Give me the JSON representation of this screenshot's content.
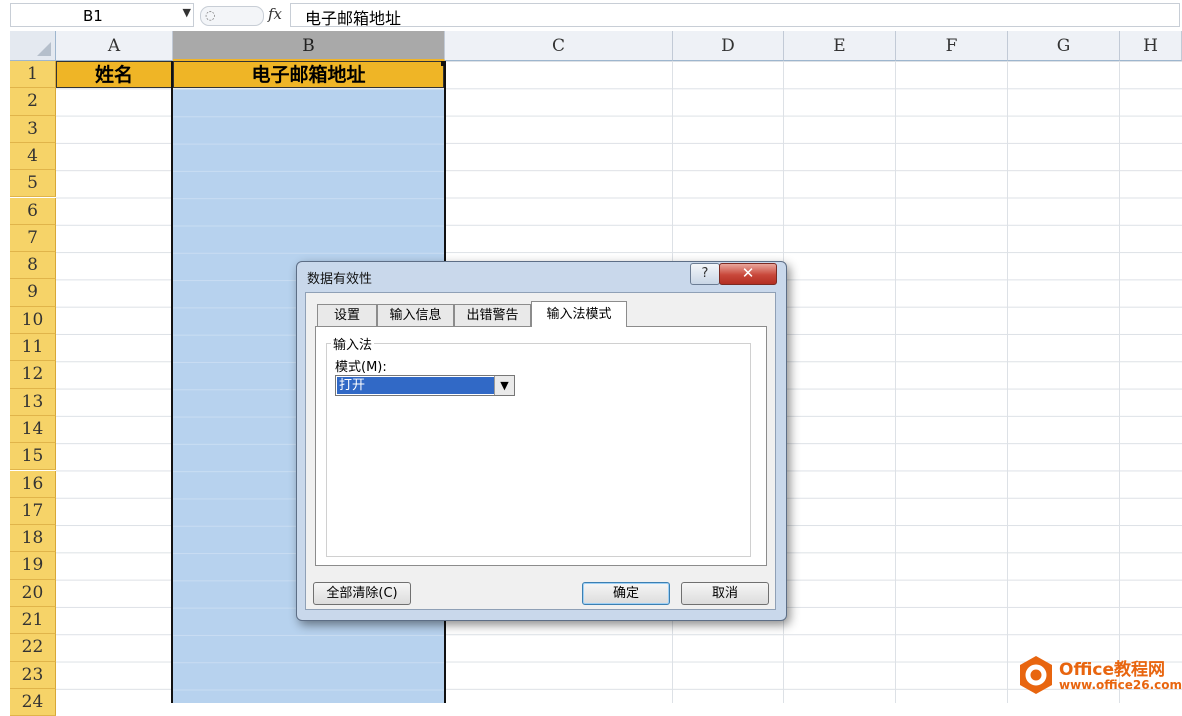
{
  "formula_bar": {
    "name_box": "B1",
    "fx": "fx",
    "formula": "电子邮箱地址"
  },
  "sheet": {
    "columns": [
      "A",
      "B",
      "C",
      "D",
      "E",
      "F",
      "G",
      "H"
    ],
    "selected_column": "B",
    "rows": [
      "1",
      "2",
      "3",
      "4",
      "5",
      "6",
      "7",
      "8",
      "9",
      "10",
      "11",
      "12",
      "13",
      "14",
      "15",
      "16",
      "17",
      "18",
      "19",
      "20",
      "21",
      "22",
      "23",
      "24"
    ],
    "cells": {
      "A1": "姓名",
      "B1": "电子邮箱地址"
    },
    "colors": {
      "header_fill": "#efb526",
      "selection": "#b7d2ee",
      "row_header": "#f6d368"
    }
  },
  "dialog": {
    "title": "数据有效性",
    "help": "?",
    "close": "✕",
    "tabs": [
      "设置",
      "输入信息",
      "出错警告",
      "输入法模式"
    ],
    "active_tab": "输入法模式",
    "group_label": "输入法",
    "mode_label": "模式(M):",
    "mode_value": "打开",
    "buttons": {
      "clear_all": "全部清除(C)",
      "ok": "确定",
      "cancel": "取消"
    }
  },
  "watermark": {
    "brand": "Office教程网",
    "url": "www.office26.com"
  }
}
